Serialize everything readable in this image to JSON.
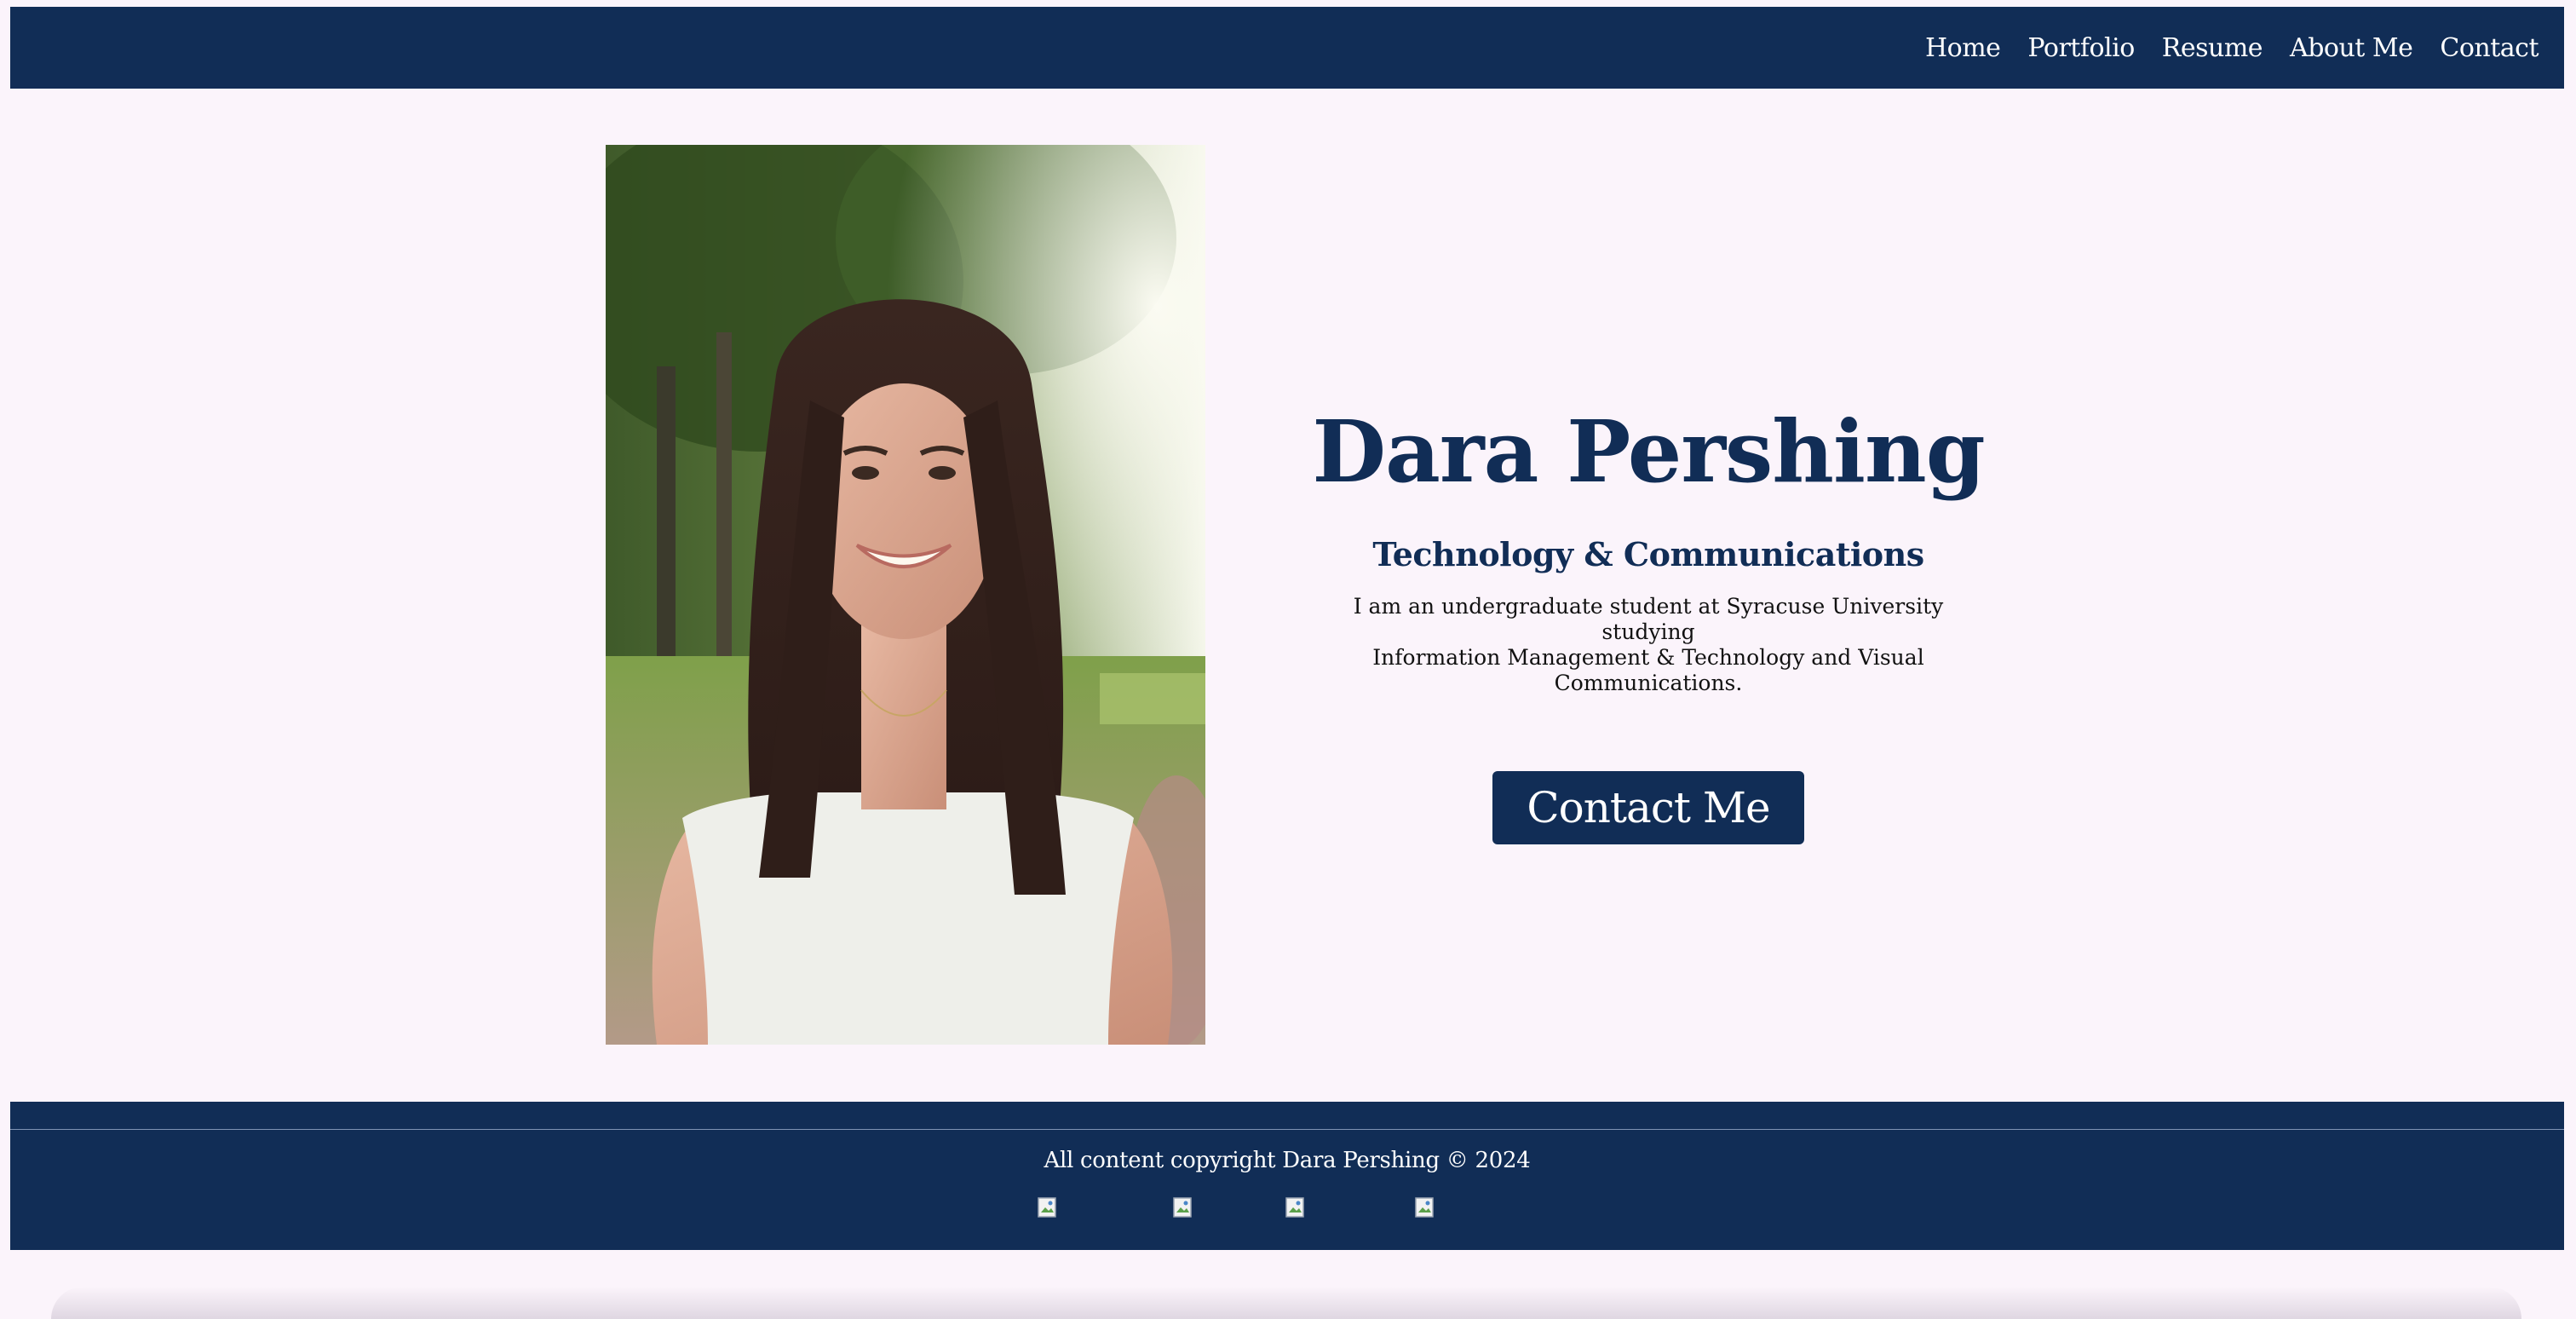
{
  "nav": {
    "items": [
      {
        "label": "Home"
      },
      {
        "label": "Portfolio"
      },
      {
        "label": "Resume"
      },
      {
        "label": "About Me"
      },
      {
        "label": "Contact"
      }
    ]
  },
  "hero": {
    "name": "Dara Pershing",
    "subtitle": "Technology & Communications",
    "bio_line1": "I am an undergraduate student at Syracuse University studying",
    "bio_line2": "Information Management & Technology and Visual Communications.",
    "cta_label": "Contact Me"
  },
  "footer": {
    "copyright": "All content copyright Dara Pershing © 2024",
    "social_icons": [
      "broken-image-icon",
      "broken-image-icon",
      "broken-image-icon",
      "broken-image-icon"
    ]
  },
  "colors": {
    "navy": "#112d56",
    "background": "#fbf4fb",
    "text_light": "#ffffff"
  }
}
